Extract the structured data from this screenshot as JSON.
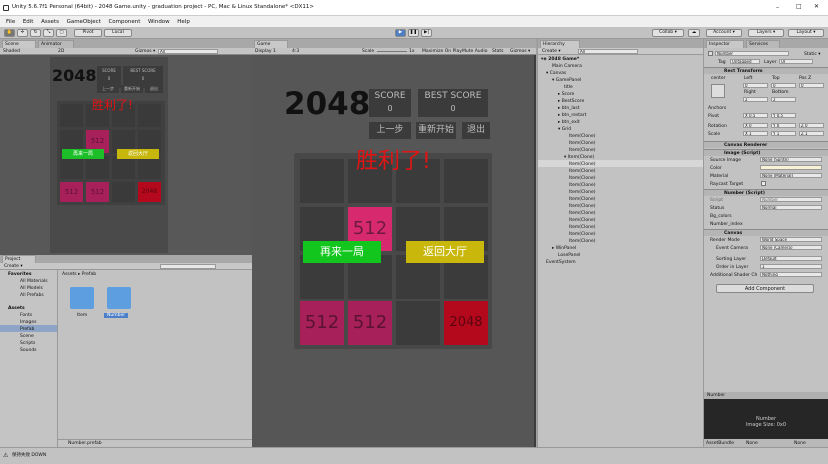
{
  "window": {
    "title": "Unity 5.6.7f1 Personal (64bit) - 2048 Game.unity - graduation project - PC, Mac & Linux Standalone* <DX11>",
    "min": "–",
    "max": "□",
    "close": "✕"
  },
  "menu": [
    "File",
    "Edit",
    "Assets",
    "GameObject",
    "Component",
    "Window",
    "Help"
  ],
  "toolbar": {
    "pivot": "Pivot",
    "local": "Local",
    "collab": "Collab ▾",
    "account": "Account ▾",
    "layers": "Layers ▾",
    "layout": "Layout ▾"
  },
  "scene": {
    "tab_scene": "Scene",
    "tab_animator": "Animator",
    "shaded": "Shaded",
    "mode2d": "2D",
    "gizmos": "Gizmos ▾",
    "search": "All",
    "title": "2048",
    "score": "SCORE",
    "score_val": "0",
    "best": "BEST SCORE",
    "best_val": "0",
    "btn_last": "上一步",
    "btn_restart": "重新开始",
    "btn_exit": "退出",
    "win_text": "胜利了!",
    "again": "再来一局",
    "back": "返回大厅",
    "tiles": [
      "512",
      "512",
      "512",
      "2048"
    ]
  },
  "game": {
    "tab": "Game",
    "display": "Display 1",
    "aspect": "4:3",
    "scale_label": "Scale",
    "scale_val": "1x",
    "maximize": "Maximize On Play",
    "mute": "Mute Audio",
    "stats": "Stats",
    "gizmos": "Gizmos ▾",
    "title": "2048",
    "score": "SCORE",
    "score_val": "0",
    "best": "BEST SCORE",
    "best_val": "0",
    "btn_last": "上一步",
    "btn_restart": "重新开始",
    "btn_exit": "退出",
    "win_text": "胜利了!",
    "again": "再来一局",
    "back": "返回大厅",
    "tile_center": "512",
    "tile_a": "512",
    "tile_b": "512",
    "tile_c": "2048"
  },
  "hierarchy": {
    "tab": "Hierarchy",
    "create": "Create ▾",
    "search": "All",
    "items": [
      "2048 Game*",
      "Main Camera",
      "Canvas",
      "GamePanel",
      "title",
      "Score",
      "BestScore",
      "btn_last",
      "btn_restart",
      "btn_exit",
      "Grid",
      "Item(Clone)",
      "Item(Clone)",
      "Item(Clone)",
      "Item(Clone)",
      "Item(Clone)",
      "Item(Clone)",
      "Item(Clone)",
      "Item(Clone)",
      "Item(Clone)",
      "Item(Clone)",
      "Item(Clone)",
      "Item(Clone)",
      "Item(Clone)",
      "Item(Clone)",
      "Item(Clone)",
      "Item(Clone)",
      "WinPanel",
      "LosePanel",
      "EventSystem"
    ]
  },
  "inspector": {
    "tab": "Inspector",
    "tab2": "Services",
    "name": "Number",
    "static": "Static ▾",
    "tag_label": "Tag",
    "tag": "Untagged",
    "layer_label": "Layer",
    "layer": "UI",
    "rect": "Rect Transform",
    "center": "center",
    "left": "Left",
    "top": "Top",
    "posz": "Pos Z",
    "left_v": "0",
    "top_v": "0",
    "posz_v": "0",
    "right": "Right",
    "bottom": "Bottom",
    "right_v": "2",
    "bottom_v": "2",
    "anchors": "Anchors",
    "pivot": "Pivot",
    "pivot_x": "X 0.5",
    "pivot_y": "Y 0.5",
    "rotation": "Rotation",
    "rot_x": "X 0",
    "rot_y": "Y 0",
    "rot_z": "Z 0",
    "scale": "Scale",
    "sc_x": "X 1",
    "sc_y": "Y 1",
    "sc_z": "Z 1",
    "canvas_renderer": "Canvas Renderer",
    "image": "Image (Script)",
    "source_image": "Source Image",
    "source_val": "None (Sprite)",
    "color": "Color",
    "material": "Material",
    "material_val": "None (Material)",
    "raycast": "Raycast Target",
    "number_script": "Number (Script)",
    "script_label": "Script",
    "script_val": "Number",
    "status_label": "Status",
    "status_val": "Normal",
    "bg_colors": "Bg_colors",
    "number_index": "Number_index",
    "canvas": "Canvas",
    "render_mode": "Render Mode",
    "render_val": "World Space",
    "event_camera": "Event Camera",
    "event_val": "None (Camera)",
    "sorting_layer": "Sorting Layer",
    "sorting_val": "Default",
    "order": "Order in Layer",
    "order_val": "1",
    "additional": "Additional Shader Ch",
    "additional_val": "Nothing",
    "add_component": "Add Component",
    "preview_title": "Number",
    "preview_name": "Number",
    "preview_size": "Image Size: 0x0",
    "assetbundle": "AssetBundle",
    "ab_val": "None",
    "ab_val2": "None"
  },
  "project": {
    "tab": "Project",
    "create": "Create ▾",
    "favorites": "Favorites",
    "fav_items": [
      "All Materials",
      "All Models",
      "All Prefabs"
    ],
    "assets": "Assets",
    "asset_items": [
      "Fonts",
      "Images",
      "Prefab",
      "Scene",
      "Scripts",
      "Sounds"
    ],
    "breadcrumb": "Assets ▸ Prefab",
    "files": [
      "Item",
      "Number"
    ],
    "footer": "Number.prefab"
  },
  "status": {
    "text": "保持失败   DOWN"
  }
}
